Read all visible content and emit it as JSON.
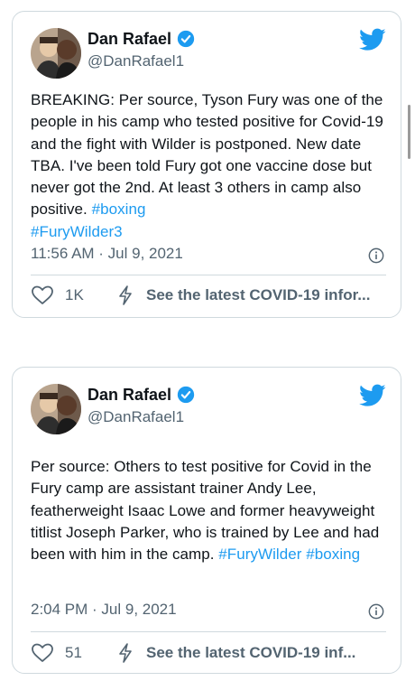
{
  "tweets": [
    {
      "author_name": "Dan Rafael",
      "handle": "@DanRafael1",
      "text": "BREAKING: Per source, Tyson Fury was one of the people in his camp who tested positive for Covid-19 and the fight with Wilder is postponed.  New date TBA. I've been told Fury got one vaccine dose but never got the 2nd. At least 3 others in camp also positive. ",
      "hashtags": [
        "#boxing",
        "#FuryWilder3"
      ],
      "timestamp": "11:56 AM · Jul 9, 2021",
      "likes": "1K",
      "covid_link": "See the latest COVID-19 infor..."
    },
    {
      "author_name": "Dan Rafael",
      "handle": "@DanRafael1",
      "text": "Per source: Others to test positive for Covid in the Fury camp are assistant trainer Andy Lee, featherweight Isaac Lowe and former heavyweight titlist Joseph Parker, who is trained by Lee and had been with him in the camp. ",
      "hashtags": [
        "#FuryWilder",
        "#boxing"
      ],
      "timestamp": "2:04 PM · Jul 9, 2021",
      "likes": "51",
      "covid_link": "See the latest COVID-19 inf..."
    }
  ],
  "icons": {
    "avatar": "avatar",
    "verified": "verified-badge-icon",
    "brand": "twitter-bird-icon",
    "info": "info-icon",
    "like": "heart-icon",
    "covid": "lightning-bolt-icon"
  },
  "colors": {
    "accent": "#1d9bf0",
    "secondary_text": "#536471",
    "divider": "#cfd9de"
  }
}
